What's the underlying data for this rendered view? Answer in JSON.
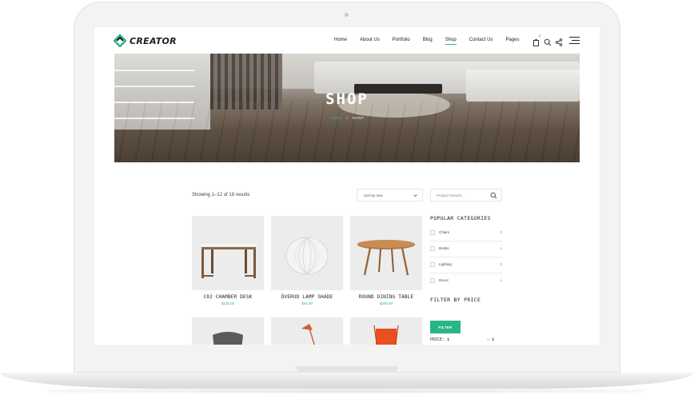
{
  "brand": {
    "name": "CREATOR",
    "accent_color": "#29b686"
  },
  "nav": {
    "items": [
      {
        "label": "Home"
      },
      {
        "label": "About Us"
      },
      {
        "label": "Portfolio"
      },
      {
        "label": "Blog"
      },
      {
        "label": "Shop",
        "active": true
      },
      {
        "label": "Contact Us"
      },
      {
        "label": "Pages"
      }
    ],
    "cart_count": "2",
    "icons": [
      "cart-icon",
      "search-icon",
      "share-icon",
      "menu-icon"
    ]
  },
  "hero": {
    "title": "SHOP",
    "breadcrumb": {
      "home": "HOME",
      "separator": "/",
      "current": "SHOP"
    }
  },
  "toolbar": {
    "results_text": "Showing 1–12 of 18 results",
    "sort_value": "Sort by new",
    "search_placeholder": "Product Search..."
  },
  "products": [
    {
      "name": "C02 CHAMBER DESK",
      "price": "$120.00"
    },
    {
      "name": "ÖVERUD LAMP SHADE",
      "price": "$54.00"
    },
    {
      "name": "ROUND DINING TABLE",
      "price": "$200.00"
    }
  ],
  "sidebar": {
    "categories_title": "POPULAR CATEGORIES",
    "categories": [
      {
        "label": "Chairs",
        "count": "2"
      },
      {
        "label": "Desks",
        "count": "1"
      },
      {
        "label": "Lighting",
        "count": "5"
      },
      {
        "label": "Decor",
        "count": "1"
      }
    ],
    "price_title": "FILTER BY PRICE",
    "filter_button": "FILTER",
    "price_label": "PRICE: $",
    "price_separator": "— $"
  }
}
